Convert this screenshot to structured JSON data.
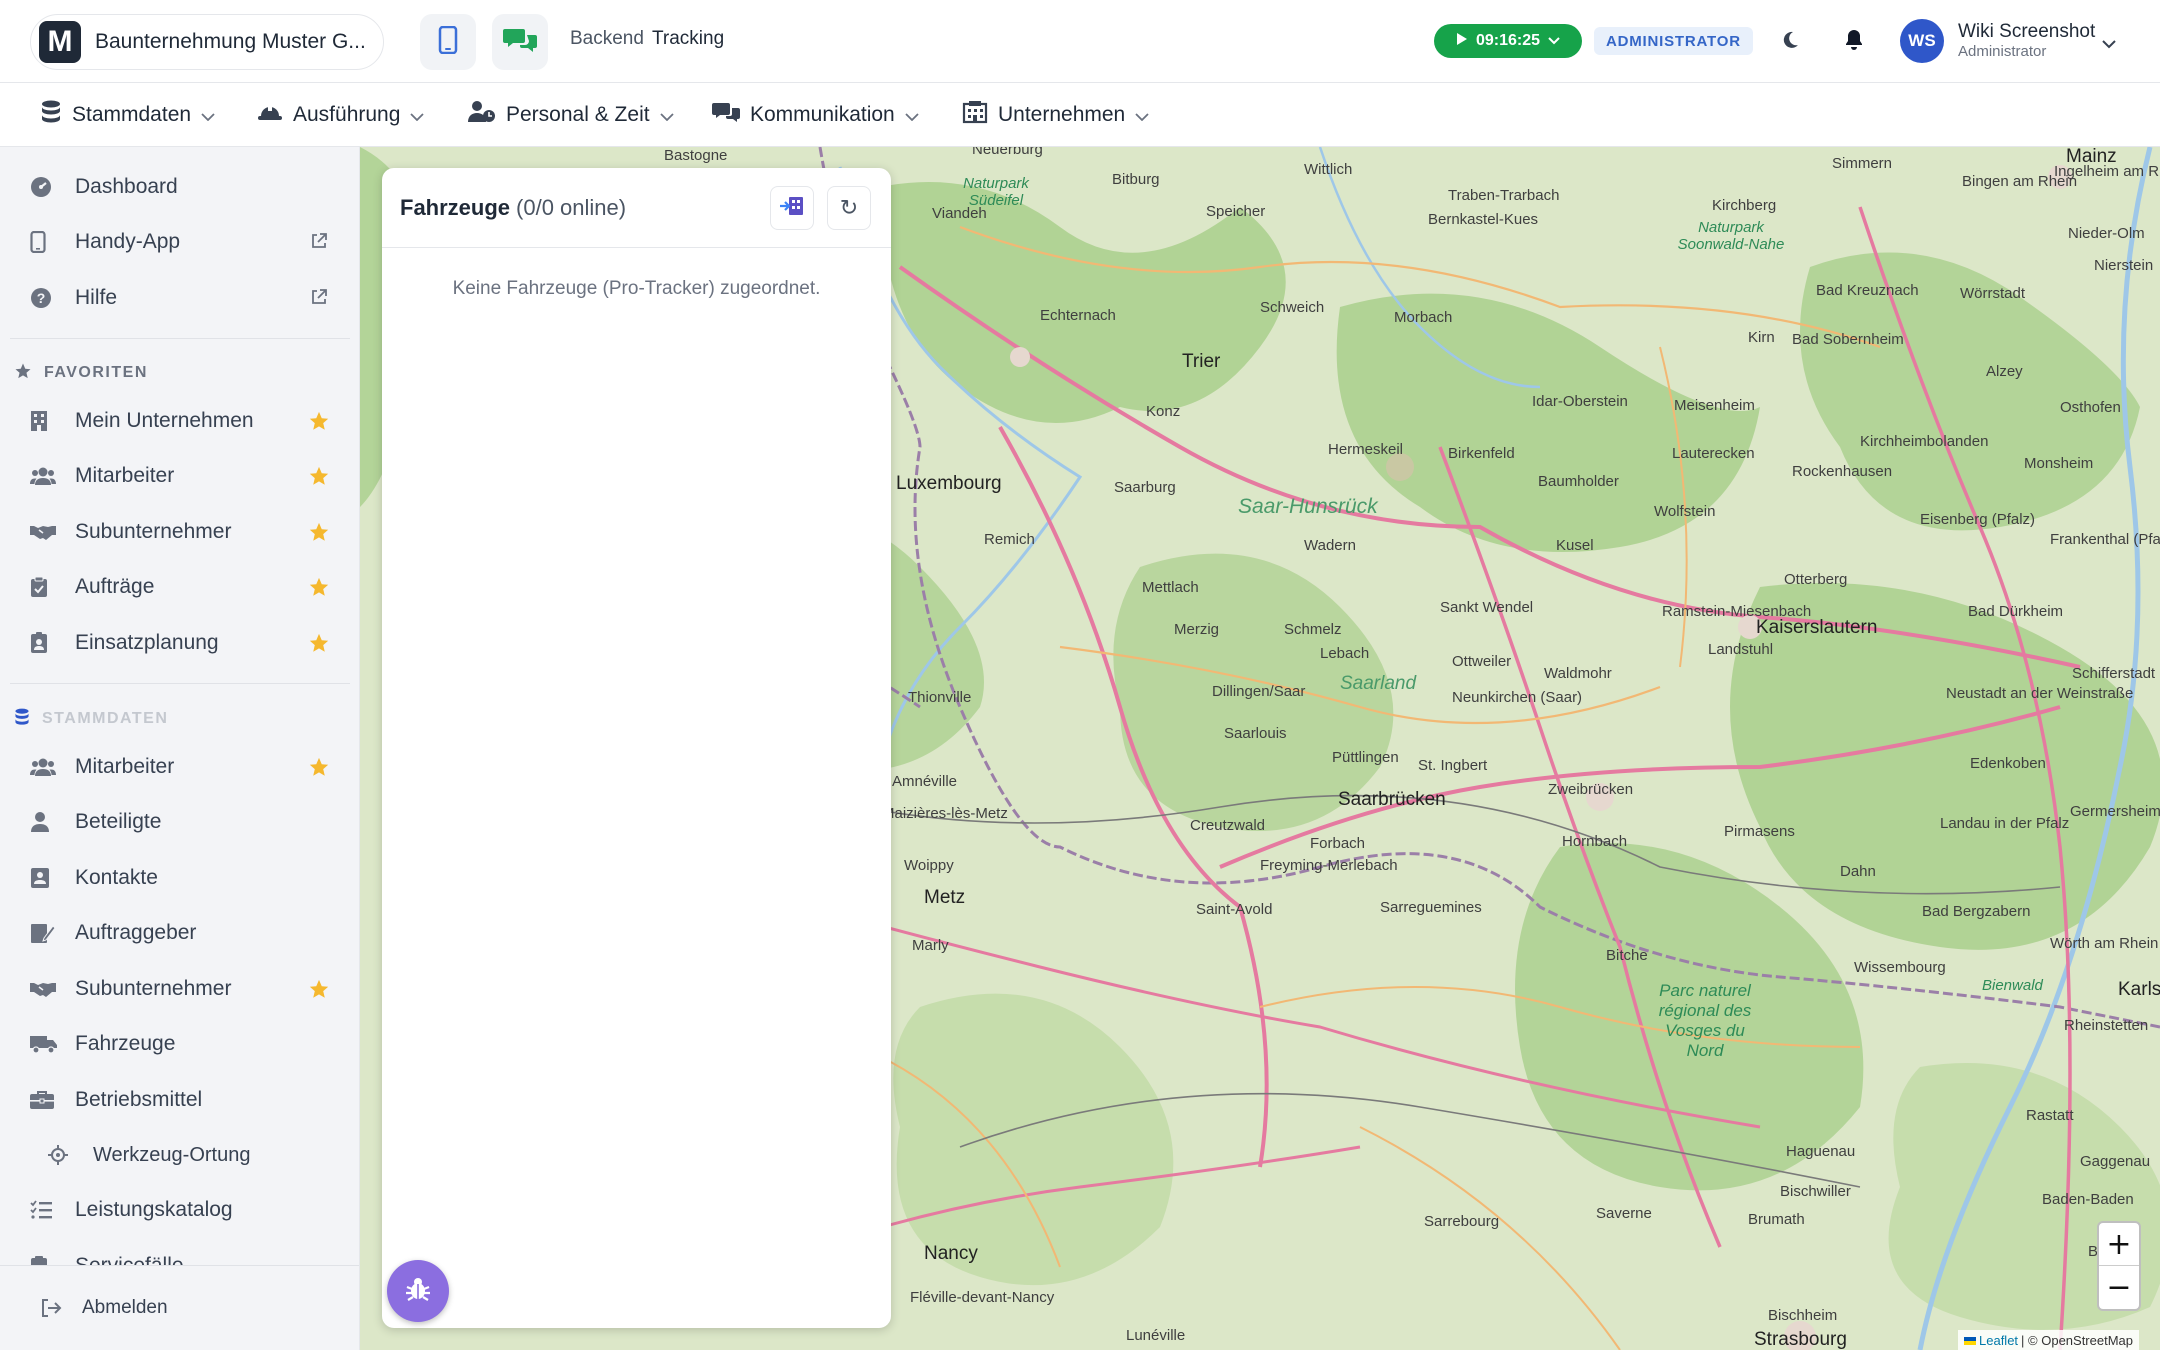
{
  "header": {
    "logo_letter": "M",
    "company_name": "Baunternehmung Muster G...",
    "breadcrumb": [
      "Backend",
      "Tracking"
    ],
    "timer": "09:16:25",
    "role_badge": "ADMINISTRATOR",
    "avatar_initials": "WS",
    "user_name": "Wiki Screenshot",
    "user_role": "Administrator"
  },
  "topnav": [
    {
      "label": "Stammdaten",
      "icon": "database-icon"
    },
    {
      "label": "Ausführung",
      "icon": "hardhat-icon"
    },
    {
      "label": "Personal & Zeit",
      "icon": "user-clock-icon"
    },
    {
      "label": "Kommunikation",
      "icon": "chat-icon"
    },
    {
      "label": "Unternehmen",
      "icon": "building-icon"
    }
  ],
  "sidebar": {
    "top_items": [
      {
        "label": "Dashboard",
        "icon": "dashboard-icon"
      },
      {
        "label": "Handy-App",
        "icon": "mobile-icon",
        "external": true
      },
      {
        "label": "Hilfe",
        "icon": "help-icon",
        "external": true
      }
    ],
    "favorites_title": "FAVORITEN",
    "favorites": [
      {
        "label": "Mein Unternehmen",
        "icon": "building-icon"
      },
      {
        "label": "Mitarbeiter",
        "icon": "users-icon"
      },
      {
        "label": "Subunternehmer",
        "icon": "handshake-icon"
      },
      {
        "label": "Aufträge",
        "icon": "clipboard-icon"
      },
      {
        "label": "Einsatzplanung",
        "icon": "id-badge-icon"
      }
    ],
    "stammdaten_title": "STAMMDATEN",
    "stammdaten": [
      {
        "label": "Mitarbeiter",
        "icon": "users-icon",
        "starred": true
      },
      {
        "label": "Beteiligte",
        "icon": "user-icon",
        "starred": false
      },
      {
        "label": "Kontakte",
        "icon": "contact-card-icon",
        "starred": false
      },
      {
        "label": "Auftraggeber",
        "icon": "signature-icon",
        "starred": false
      },
      {
        "label": "Subunternehmer",
        "icon": "handshake-icon",
        "starred": true
      },
      {
        "label": "Fahrzeuge",
        "icon": "truck-icon",
        "starred": false
      },
      {
        "label": "Betriebsmittel",
        "icon": "toolbox-icon",
        "starred": false
      },
      {
        "label": "Werkzeug-Ortung",
        "icon": "crosshair-icon",
        "starred": false,
        "sub": true
      },
      {
        "label": "Leistungskatalog",
        "icon": "list-icon",
        "starred": false
      },
      {
        "label": "Servicefälle",
        "icon": "clipboard-icon",
        "starred": false
      }
    ],
    "logout_label": "Abmelden"
  },
  "panel": {
    "title": "Fahrzeuge",
    "subtitle": "(0/0 online)",
    "empty_text": "Keine Fahrzeuge (Pro-Tracker) zugeordnet.",
    "refresh_glyph": "↻"
  },
  "map": {
    "zoom_in": "+",
    "zoom_out": "−",
    "attribution_link": "Leaflet",
    "attribution_text": "| © OpenStreetMap",
    "labels": [
      "Bastogne",
      "Neuerburg",
      "Bitburg",
      "Wittlich",
      "Traben-Trarbach",
      "Bernkastel-Kues",
      "Kirchberg",
      "Simmern",
      "Bingen am Rhein",
      "Ingelheim am Rhein",
      "Mainz",
      "Nieder-Olm",
      "Nierstein",
      "Viandeh",
      "Speicher",
      "Echternach",
      "Schweich",
      "Morbach",
      "Bad Kreuznach",
      "Wörrstadt",
      "Trier",
      "Kirn",
      "Bad Sobernheim",
      "Alzey",
      "Osthofen",
      "Konz",
      "Idar-Oberstein",
      "Meisenheim",
      "Hermeskeil",
      "Birkenfeld",
      "Lauterecken",
      "Kirchheimbolanden",
      "Saarburg",
      "Baumholder",
      "Rockenhausen",
      "Monsheim",
      "Wolfstein",
      "Eisenberg (Pfalz)",
      "Frankenthal (Pfalz)",
      "Remich",
      "Wadern",
      "Kusel",
      "Otterberg",
      "Mettlach",
      "Sankt Wendel",
      "Ramstein-Miesenbach",
      "Kaiserslautern",
      "Bad Dürkheim",
      "Merzig",
      "Schmelz",
      "Landstuhl",
      "Lebach",
      "Ottweiler",
      "Waldmohr",
      "Schifferstadt",
      "Thionville",
      "Dillingen/Saar",
      "Neunkirchen (Saar)",
      "Neustadt an der Weinstraße",
      "Saarlouis",
      "Püttlingen",
      "St. Ingbert",
      "Edenkoben",
      "Amnéville",
      "Saarbrücken",
      "Zweibrücken",
      "Maizières-lès-Metz",
      "Creutzwald",
      "Forbach",
      "Hornbach",
      "Pirmasens",
      "Landau in der Pfalz",
      "Germersheim",
      "Woippy",
      "Freyming-Merlebach",
      "Dahn",
      "Metz",
      "Saint-Avold",
      "Sarreguemines",
      "Bad Bergzabern",
      "Marly",
      "Bitche",
      "Wissembourg",
      "Wörth am Rhein",
      "Karlsruhe",
      "Rheinstetten",
      "Rastatt",
      "Haguenau",
      "Gaggenau",
      "Bischwiller",
      "Baden-Baden",
      "Sarrebourg",
      "Saverne",
      "Brumath",
      "Bühl",
      "Nancy",
      "Fléville-devant-Nancy",
      "Lunéville",
      "Bischheim",
      "Strasbourg",
      "Luxembourg",
      "Saar-Hunsrück",
      "Saarland",
      "Naturpark Südeifel",
      "Naturpark Soonwald-Nahe",
      "Parc naturel régional des Vosges du Nord",
      "Bienwald"
    ]
  }
}
